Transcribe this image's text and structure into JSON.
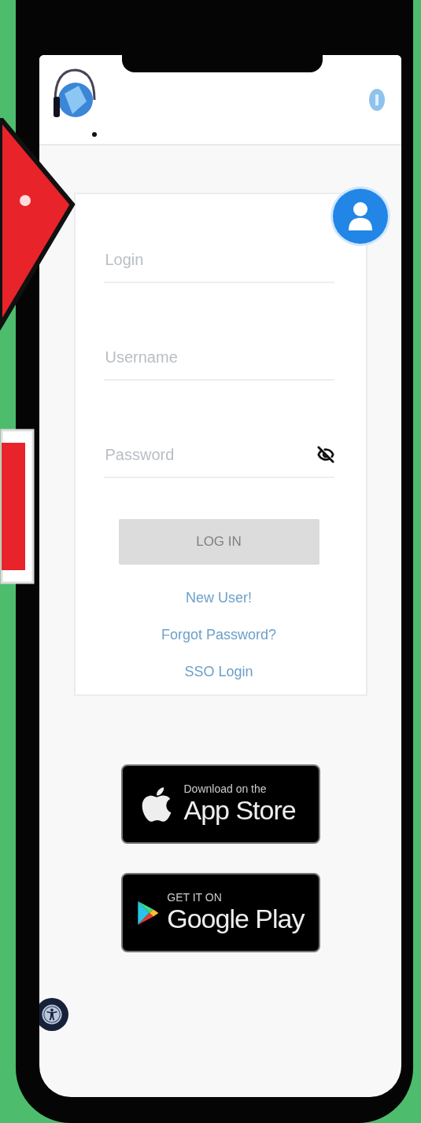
{
  "login_card": {
    "fields": [
      {
        "kind": "text",
        "placeholder": "Login"
      },
      {
        "kind": "text",
        "placeholder": "Username"
      },
      {
        "kind": "password",
        "placeholder": "Password"
      }
    ],
    "submit": {
      "label": "LOG IN",
      "disabled": true
    },
    "links": [
      "New User!",
      "Forgot Password?",
      "SSO Login"
    ]
  },
  "store_badges": [
    {
      "kind": "apple",
      "small": "Download on the",
      "large": "App Store"
    },
    {
      "kind": "google",
      "small": "GET IT ON",
      "large": "Google Play"
    }
  ]
}
